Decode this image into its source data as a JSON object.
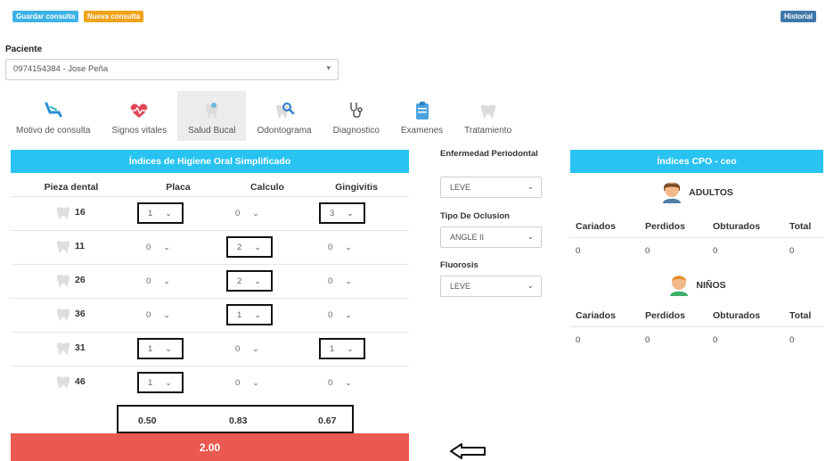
{
  "toolbar": {
    "guardar_label": "Guardar consulta",
    "nueva_label": "Nueva consulta",
    "historial_label": "Historial"
  },
  "patient": {
    "label": "Paciente",
    "value": "0974154384 - Jose Peña"
  },
  "tabs": [
    {
      "label": "Motivo de consulta",
      "icon": "dental-chair-icon"
    },
    {
      "label": "Signos vitales",
      "icon": "heartbeat-icon"
    },
    {
      "label": "Salud Bucal",
      "icon": "tooth-sparkle-icon",
      "active": true
    },
    {
      "label": "Odontograma",
      "icon": "tooth-search-icon"
    },
    {
      "label": "Diagnostico",
      "icon": "stethoscope-icon"
    },
    {
      "label": "Examenes",
      "icon": "clipboard-icon"
    },
    {
      "label": "Tratamiento",
      "icon": "tooth-icon"
    }
  ],
  "ihos": {
    "title": "Índices de Higiene Oral Simplificado",
    "headers": [
      "Pieza dental",
      "Placa",
      "Calculo",
      "Gingivitis"
    ],
    "rows": [
      {
        "pieza": "16",
        "placa": "1",
        "calculo": "0",
        "gingivitis": "3"
      },
      {
        "pieza": "11",
        "placa": "0",
        "calculo": "2",
        "gingivitis": "0"
      },
      {
        "pieza": "26",
        "placa": "0",
        "calculo": "2",
        "gingivitis": "0"
      },
      {
        "pieza": "36",
        "placa": "0",
        "calculo": "1",
        "gingivitis": "0"
      },
      {
        "pieza": "31",
        "placa": "1",
        "calculo": "0",
        "gingivitis": "1"
      },
      {
        "pieza": "46",
        "placa": "1",
        "calculo": "0",
        "gingivitis": "0"
      }
    ],
    "totals": {
      "placa": "0.50",
      "calculo": "0.83",
      "gingivitis": "0.67"
    },
    "result": "2.00"
  },
  "middle": {
    "enfermedad_label": "Enfermedad Periodontal",
    "enfermedad_value": "LEVE",
    "oclusion_label": "Tipo De Oclusion",
    "oclusion_value": "ANGLE II",
    "fluorosis_label": "Fluorosis",
    "fluorosis_value": "LEVE"
  },
  "cpo": {
    "title": "Índices CPO - ceo",
    "headers": [
      "Cariados",
      "Perdidos",
      "Obturados",
      "Total"
    ],
    "adultos": {
      "label": "ADULTOS",
      "values": [
        "0",
        "0",
        "0",
        "0"
      ]
    },
    "ninos": {
      "label": "NIÑOS",
      "values": [
        "0",
        "0",
        "0",
        "0"
      ]
    }
  },
  "colors": {
    "header_blue": "#29c3f2",
    "result_red": "#e9594f",
    "guardar": "#3cb3e6",
    "nueva": "#f0a318",
    "historial": "#3f78a8"
  }
}
